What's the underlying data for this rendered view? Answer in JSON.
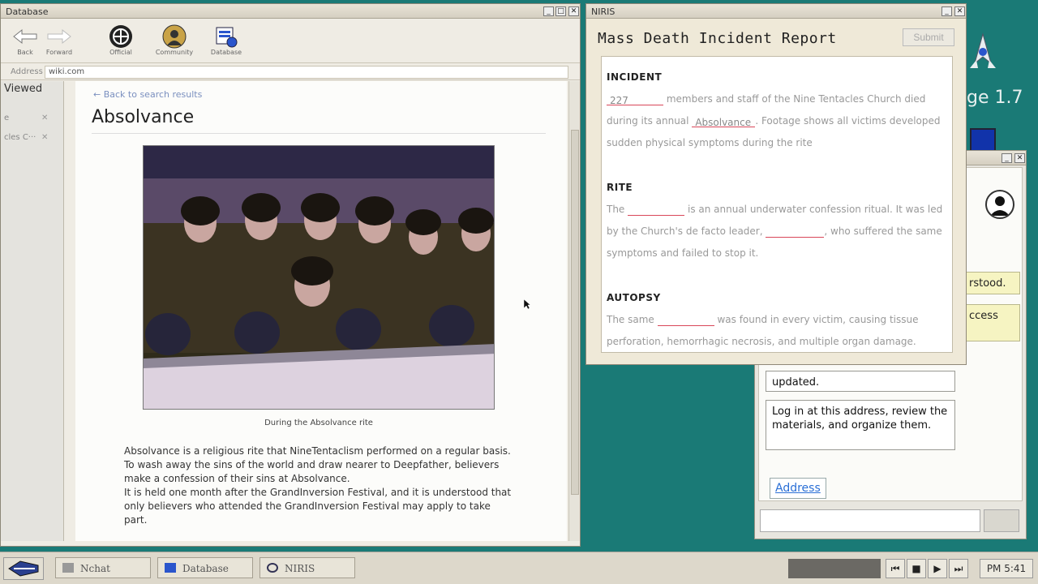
{
  "desktop": {
    "version_text": "ge 1.7"
  },
  "chat": {
    "bubble_understood": "rstood.",
    "bubble_access": "ccess",
    "bubble_updated": "updated.",
    "bubble_login": "Log in at this address, review the materials, and organize them.",
    "address_link": "Address"
  },
  "database": {
    "window_title": "Database",
    "toolbar": {
      "back_label": "Back",
      "forward_label": "Forward",
      "official_label": "Official",
      "community_label": "Community",
      "database_label": "Database"
    },
    "address_label": "Address",
    "address_value": "wiki.com",
    "sidebar": {
      "header": "Viewed",
      "items": [
        {
          "label": "e"
        },
        {
          "label": "cles C···"
        }
      ]
    },
    "back_link": "← Back to search results",
    "article_title": "Absolvance",
    "caption": "During the Absolvance rite",
    "paragraphs": [
      "Absolvance is a religious rite that NineTentaclism performed on a regular basis.",
      "To wash away the sins of the world and draw nearer to Deepfather, believers make a confession of their sins at Absolvance.",
      "It is held one month after the GrandInversion Festival, and it is understood that only believers who attended the GrandInversion Festival may apply to take part."
    ]
  },
  "niris": {
    "window_title": "NIRIS",
    "report_title": "Mass Death Incident Report",
    "submit_label": "Submit",
    "incident": {
      "heading": "INCIDENT",
      "blank1": "227",
      "text1": "members and staff of the Nine Tentacles Church died",
      "text2": "during its annual",
      "blank2": "Absolvance",
      "text3": ". Footage shows all victims developed",
      "text4": "sudden physical symptoms during the rite"
    },
    "rite": {
      "heading": "RITE",
      "text1": "The",
      "text2": "is an annual underwater confession ritual. It was led",
      "text3": "by the Church's de facto leader,",
      "text4": ", who suffered the same",
      "text5": "symptoms and failed to stop it."
    },
    "autopsy": {
      "heading": "AUTOPSY",
      "text1": "The same",
      "text2": "was found in every victim, causing tissue",
      "text3": "perforation, hemorrhagic necrosis, and multiple organ damage."
    }
  },
  "taskbar": {
    "tasks": [
      {
        "label": "Nchat"
      },
      {
        "label": "Database"
      },
      {
        "label": "NIRIS"
      }
    ],
    "clock": "PM 5:41"
  },
  "colors": {
    "desktop": "#1a7a76",
    "blank_underline": "#d9475a",
    "link": "#2a6fd6"
  }
}
